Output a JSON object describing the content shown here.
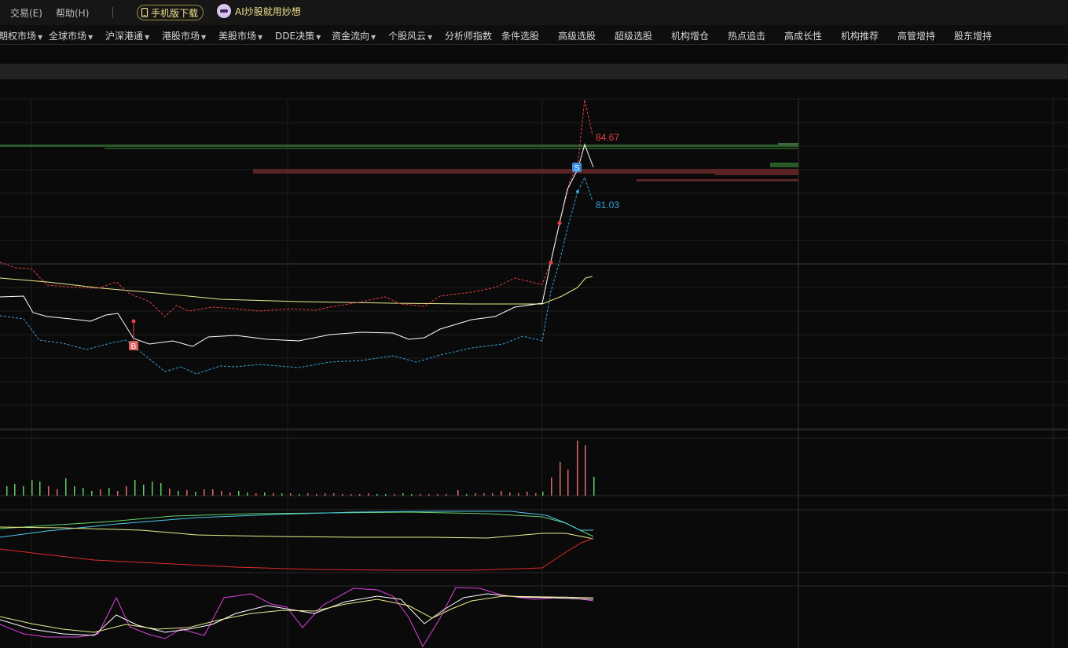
{
  "menu": {
    "trade": "交易(E)",
    "help": "帮助(H)"
  },
  "promo": {
    "mobile_download": "手机版下载",
    "ai_slogan": "AI炒股就用妙想"
  },
  "nav": [
    {
      "label": "期权市场",
      "dropdown": true
    },
    {
      "label": "全球市场",
      "dropdown": true
    },
    {
      "label": "沪深港通",
      "dropdown": true
    },
    {
      "label": "港股市场",
      "dropdown": true
    },
    {
      "label": "美股市场",
      "dropdown": true
    },
    {
      "label": "DDE决策",
      "dropdown": true
    },
    {
      "label": "资金流向",
      "dropdown": true
    },
    {
      "label": "个股风云",
      "dropdown": true
    },
    {
      "label": "分析师指数",
      "dropdown": false
    },
    {
      "label": "条件选股",
      "dropdown": false
    },
    {
      "label": "高级选股",
      "dropdown": false
    },
    {
      "label": "超级选股",
      "dropdown": false
    },
    {
      "label": "机构增仓",
      "dropdown": false
    },
    {
      "label": "热点追击",
      "dropdown": false
    },
    {
      "label": "高成长性",
      "dropdown": false
    },
    {
      "label": "机构推荐",
      "dropdown": false
    },
    {
      "label": "高管增持",
      "dropdown": false
    },
    {
      "label": "股东增持",
      "dropdown": false
    }
  ],
  "chart": {
    "upper_band_label": "84.67",
    "lower_band_label": "81.03",
    "buy_marker": "B",
    "sell_marker": "S",
    "colors": {
      "price": "#ffffff",
      "upper": "#e8404a",
      "lower": "#3aa0d8",
      "ma": "#ecec8c",
      "up": "#e06b6b",
      "down": "#5ccf64"
    }
  }
}
